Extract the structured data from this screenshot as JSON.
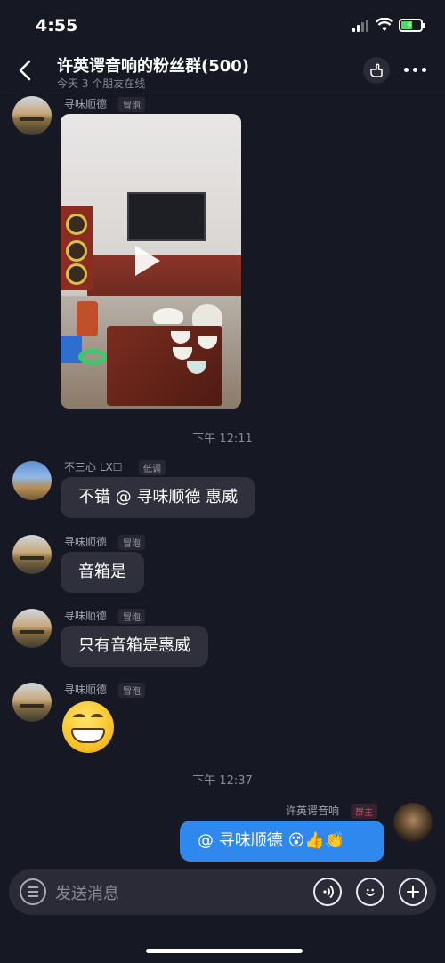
{
  "status_bar": {
    "time": "4:55"
  },
  "header": {
    "title": "许英谔音响的粉丝群(500)",
    "subtitle": "今天 3 个朋友在线"
  },
  "messages": [
    {
      "sender": "寻味顺德",
      "tag": "冒泡",
      "type": "video"
    },
    {
      "timestamp": "下午 12:11"
    },
    {
      "sender": "不三心 LX☐",
      "tag": "低调",
      "text": "不错 @ 寻味顺德 惠威"
    },
    {
      "sender": "寻味顺德",
      "tag": "冒泡",
      "text": "音箱是"
    },
    {
      "sender": "寻味顺德",
      "tag": "冒泡",
      "text": "只有音箱是惠威"
    },
    {
      "sender": "寻味顺德",
      "tag": "冒泡",
      "type": "emoji",
      "emoji": "grinning-face"
    },
    {
      "timestamp": "下午 12:37"
    },
    {
      "sender": "许英谔音响",
      "tag": "群主",
      "text": "@ 寻味顺德 😵👍👏",
      "mine": true
    }
  ],
  "input": {
    "placeholder": "发送消息"
  },
  "icons": {
    "back": "chevron-left-icon",
    "hand": "pointing-hand-icon",
    "more": "more-dots-icon",
    "menu": "menu-icon",
    "voice": "voice-icon",
    "emoji": "emoji-icon",
    "plus": "plus-icon"
  },
  "colors": {
    "background": "#161823",
    "bubble_other": "#2f303b",
    "bubble_mine": "#2f88ee",
    "owner_tag": "#e0415e"
  }
}
